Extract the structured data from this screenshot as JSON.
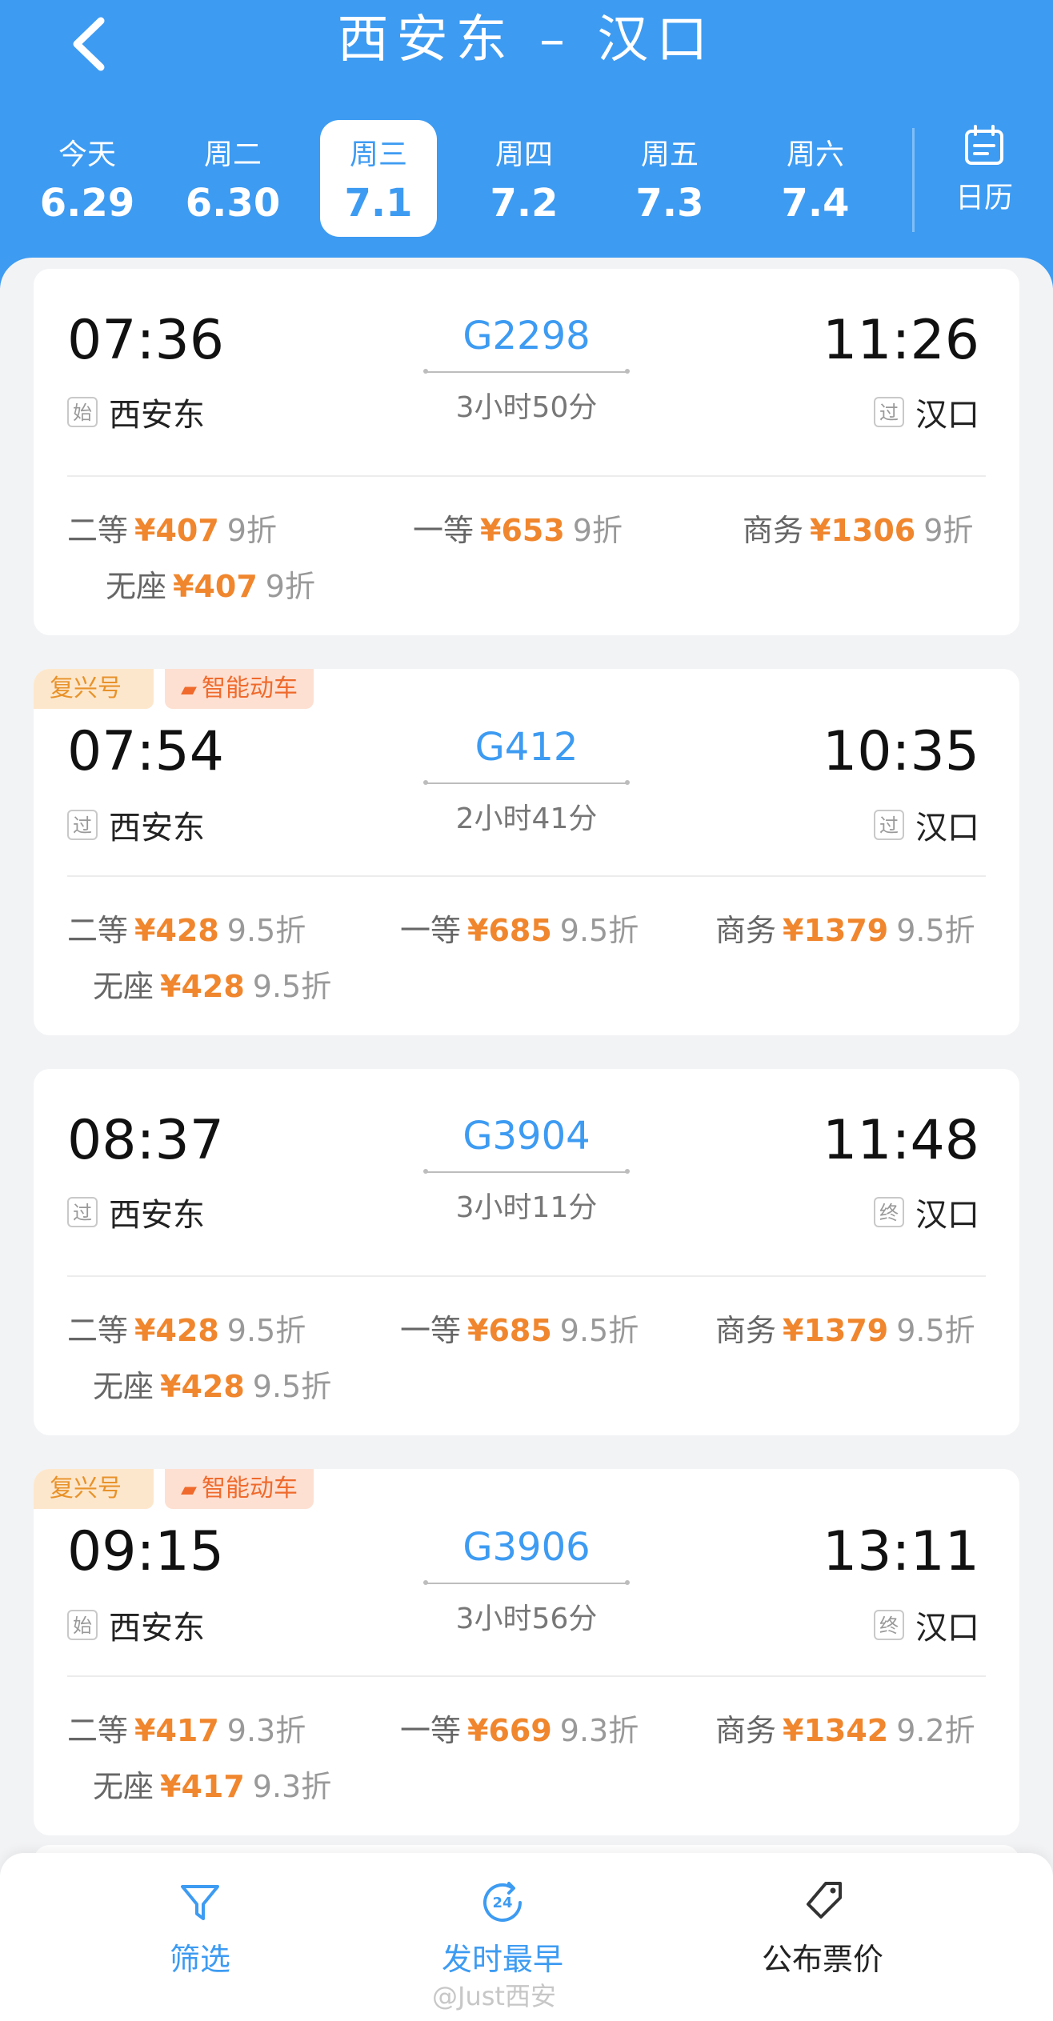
{
  "header": {
    "title": "西安东 – 汉口",
    "back_icon": "chevron-left-icon"
  },
  "dates": [
    {
      "weekday": "今天",
      "date": "6.29",
      "active": false
    },
    {
      "weekday": "周二",
      "date": "6.30",
      "active": false
    },
    {
      "weekday": "周三",
      "date": "7.1",
      "active": true
    },
    {
      "weekday": "周四",
      "date": "7.2",
      "active": false
    },
    {
      "weekday": "周五",
      "date": "7.3",
      "active": false
    },
    {
      "weekday": "周六",
      "date": "7.4",
      "active": false
    }
  ],
  "calendar": {
    "label": "日历",
    "icon": "calendar-icon"
  },
  "trains": [
    {
      "tags": [],
      "dep_time": "07:36",
      "dep_badge": "始",
      "dep_station": "西安东",
      "train_no": "G2298",
      "duration": "3小时50分",
      "arr_time": "11:26",
      "arr_badge": "过",
      "arr_station": "汉口",
      "prices": [
        {
          "cls": "二等",
          "amount": "¥407",
          "discount": "9折"
        },
        {
          "cls": "一等",
          "amount": "¥653",
          "discount": "9折"
        },
        {
          "cls": "商务",
          "amount": "¥1306",
          "discount": "9折"
        },
        {
          "cls": "无座",
          "amount": "¥407",
          "discount": "9折"
        }
      ]
    },
    {
      "tags": [
        "复兴号",
        "智能动车"
      ],
      "dep_time": "07:54",
      "dep_badge": "过",
      "dep_station": "西安东",
      "train_no": "G412",
      "duration": "2小时41分",
      "arr_time": "10:35",
      "arr_badge": "过",
      "arr_station": "汉口",
      "prices": [
        {
          "cls": "二等",
          "amount": "¥428",
          "discount": "9.5折"
        },
        {
          "cls": "一等",
          "amount": "¥685",
          "discount": "9.5折"
        },
        {
          "cls": "商务",
          "amount": "¥1379",
          "discount": "9.5折"
        },
        {
          "cls": "无座",
          "amount": "¥428",
          "discount": "9.5折"
        }
      ]
    },
    {
      "tags": [],
      "dep_time": "08:37",
      "dep_badge": "过",
      "dep_station": "西安东",
      "train_no": "G3904",
      "duration": "3小时11分",
      "arr_time": "11:48",
      "arr_badge": "终",
      "arr_station": "汉口",
      "prices": [
        {
          "cls": "二等",
          "amount": "¥428",
          "discount": "9.5折"
        },
        {
          "cls": "一等",
          "amount": "¥685",
          "discount": "9.5折"
        },
        {
          "cls": "商务",
          "amount": "¥1379",
          "discount": "9.5折"
        },
        {
          "cls": "无座",
          "amount": "¥428",
          "discount": "9.5折"
        }
      ]
    },
    {
      "tags": [
        "复兴号",
        "智能动车"
      ],
      "dep_time": "09:15",
      "dep_badge": "始",
      "dep_station": "西安东",
      "train_no": "G3906",
      "duration": "3小时56分",
      "arr_time": "13:11",
      "arr_badge": "终",
      "arr_station": "汉口",
      "prices": [
        {
          "cls": "二等",
          "amount": "¥417",
          "discount": "9.3折"
        },
        {
          "cls": "一等",
          "amount": "¥669",
          "discount": "9.3折"
        },
        {
          "cls": "商务",
          "amount": "¥1342",
          "discount": "9.2折"
        },
        {
          "cls": "无座",
          "amount": "¥417",
          "discount": "9.3折"
        }
      ]
    }
  ],
  "bottom_nav": [
    {
      "label": "筛选",
      "icon": "filter-icon"
    },
    {
      "label": "发时最早",
      "icon": "clock-24-icon",
      "icon_text": "24"
    },
    {
      "label": "公布票价",
      "icon": "price-tag-icon"
    }
  ],
  "watermark": "@Just西安",
  "colors": {
    "primary": "#3d9bf2",
    "price": "#f0862d",
    "tag_fuxing": "#e8922a",
    "tag_smart": "#ef6a2c"
  }
}
